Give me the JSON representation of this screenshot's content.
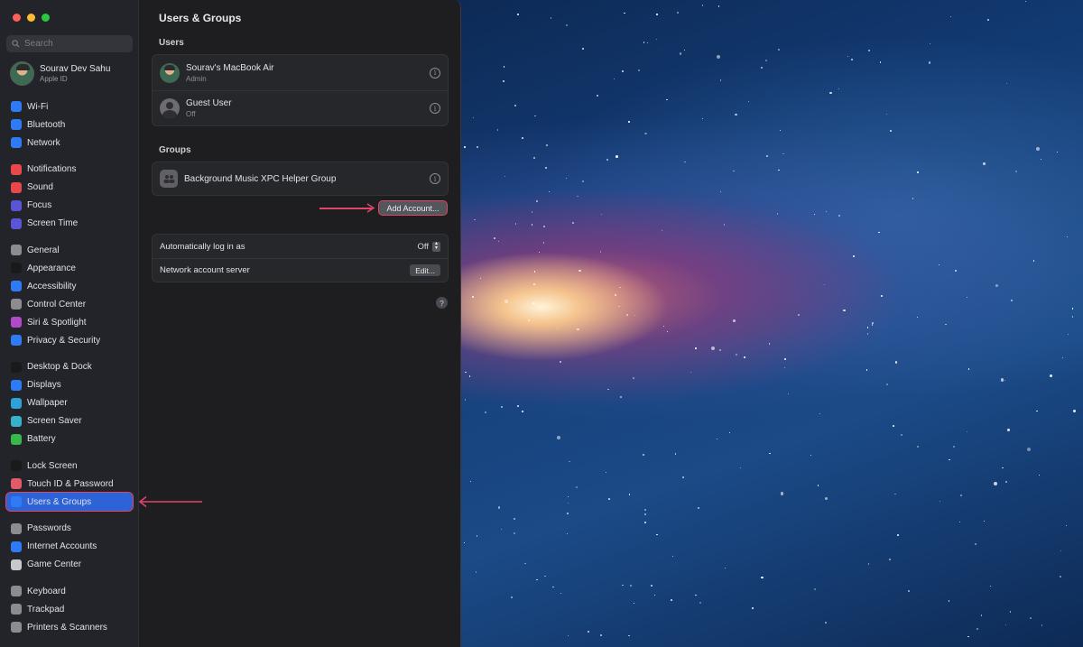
{
  "window": {
    "title": "Users & Groups"
  },
  "sidebar": {
    "search_placeholder": "Search",
    "profile": {
      "name": "Sourav Dev Sahu",
      "subtitle": "Apple ID"
    },
    "groups": [
      [
        {
          "label": "Wi-Fi",
          "icon": "wifi-icon",
          "color": "#2f7bf5"
        },
        {
          "label": "Bluetooth",
          "icon": "bluetooth-icon",
          "color": "#2f7bf5"
        },
        {
          "label": "Network",
          "icon": "globe-icon",
          "color": "#2f7bf5"
        }
      ],
      [
        {
          "label": "Notifications",
          "icon": "bell-icon",
          "color": "#e8474b"
        },
        {
          "label": "Sound",
          "icon": "speaker-icon",
          "color": "#e8474b"
        },
        {
          "label": "Focus",
          "icon": "moon-icon",
          "color": "#5b55d6"
        },
        {
          "label": "Screen Time",
          "icon": "hourglass-icon",
          "color": "#5b55d6"
        }
      ],
      [
        {
          "label": "General",
          "icon": "gear-icon",
          "color": "#8b8b90"
        },
        {
          "label": "Appearance",
          "icon": "appearance-icon",
          "color": "#1a1a1a"
        },
        {
          "label": "Accessibility",
          "icon": "accessibility-icon",
          "color": "#2f7bf5"
        },
        {
          "label": "Control Center",
          "icon": "control-center-icon",
          "color": "#8b8b90"
        },
        {
          "label": "Siri & Spotlight",
          "icon": "siri-icon",
          "color": "#b04ac9"
        },
        {
          "label": "Privacy & Security",
          "icon": "hand-icon",
          "color": "#2f7bf5"
        }
      ],
      [
        {
          "label": "Desktop & Dock",
          "icon": "dock-icon",
          "color": "#1a1a1a"
        },
        {
          "label": "Displays",
          "icon": "display-icon",
          "color": "#2f7bf5"
        },
        {
          "label": "Wallpaper",
          "icon": "wallpaper-icon",
          "color": "#2ea2d8"
        },
        {
          "label": "Screen Saver",
          "icon": "screensaver-icon",
          "color": "#37b1c9"
        },
        {
          "label": "Battery",
          "icon": "battery-icon",
          "color": "#36b84c"
        }
      ],
      [
        {
          "label": "Lock Screen",
          "icon": "lock-icon",
          "color": "#1a1a1a"
        },
        {
          "label": "Touch ID & Password",
          "icon": "fingerprint-icon",
          "color": "#e25a67"
        },
        {
          "label": "Users & Groups",
          "icon": "users-icon",
          "color": "#2f7bf5",
          "selected": true
        }
      ],
      [
        {
          "label": "Passwords",
          "icon": "key-icon",
          "color": "#8b8b90"
        },
        {
          "label": "Internet Accounts",
          "icon": "at-icon",
          "color": "#2f7bf5"
        },
        {
          "label": "Game Center",
          "icon": "game-center-icon",
          "color": "#c7c7cc"
        }
      ],
      [
        {
          "label": "Keyboard",
          "icon": "keyboard-icon",
          "color": "#8b8b90"
        },
        {
          "label": "Trackpad",
          "icon": "trackpad-icon",
          "color": "#8b8b90"
        },
        {
          "label": "Printers & Scanners",
          "icon": "printer-icon",
          "color": "#8b8b90"
        }
      ]
    ]
  },
  "main": {
    "title": "Users & Groups",
    "users_section": {
      "title": "Users",
      "users": [
        {
          "name": "Sourav's MacBook Air",
          "role": "Admin"
        },
        {
          "name": "Guest User",
          "role": "Off"
        }
      ]
    },
    "groups_section": {
      "title": "Groups",
      "groups": [
        {
          "name": "Background Music XPC Helper Group"
        }
      ]
    },
    "add_account_label": "Add Account...",
    "settings": {
      "auto_login_label": "Automatically log in as",
      "auto_login_value": "Off",
      "network_server_label": "Network account server",
      "edit_label": "Edit..."
    },
    "help_label": "?"
  },
  "annotation_color": "#e0456a"
}
